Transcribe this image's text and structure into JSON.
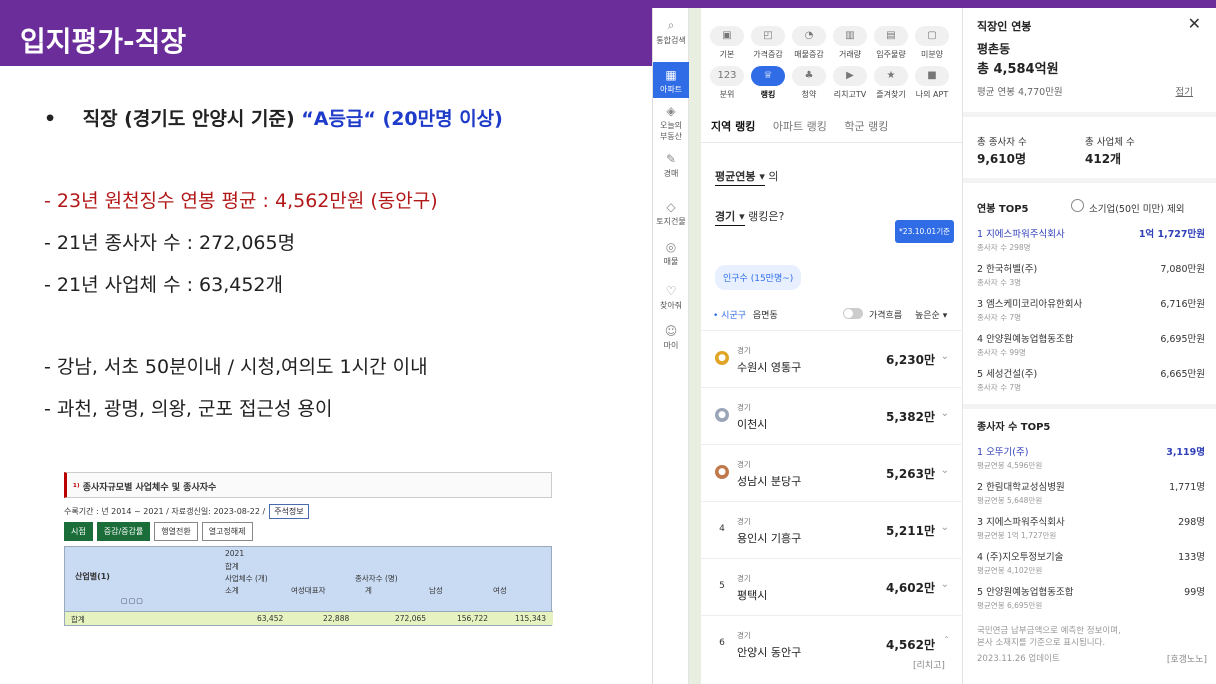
{
  "slide_title": "입지평가-직장",
  "bullet": {
    "prefix": "직장 (경기도 안양시 기준)",
    "grade": "“A등급“ (20만명 이상)"
  },
  "lines": [
    "- 23년 원천징수 연봉 평균 : 4,562만원 (동안구)",
    "- 21년 종사자 수 : 272,065명",
    "- 21년 사업체 수 : 63,452개",
    "-   강남, 서초 50분이내 / 시청,여의도 1시간 이내",
    "-   과천, 광명, 의왕, 군포 접근성 용이"
  ],
  "table": {
    "title": "종사자규모별 사업체수 및 종사자수",
    "meta": "수록기간 : 년 2014 ~ 2021 / 자료갱신일: 2023-08-22 /",
    "meta_btn": "주석정보",
    "buttons": [
      "시점",
      "증감/증감률",
      "행열전환",
      "열고정해제"
    ],
    "row_header": "산업별(1)",
    "year": "2021",
    "total": "합계",
    "g1": "사업체수 (개)",
    "g2": "종사자수 (명)",
    "cols": [
      "소계",
      "여성대표자",
      "계",
      "남성",
      "여성"
    ],
    "row_label": "합계",
    "values": [
      "63,452",
      "22,888",
      "272,065",
      "156,722",
      "115,343"
    ]
  },
  "sidebar": [
    {
      "icon": "⌕",
      "label": "통합검색"
    },
    {
      "icon": "▦",
      "label": "아파트"
    },
    {
      "icon": "◈",
      "label": "오늘의\n부동산"
    },
    {
      "icon": "✎",
      "label": "경매"
    },
    {
      "icon": "◇",
      "label": "토지건물"
    },
    {
      "icon": "◎",
      "label": "매물"
    },
    {
      "icon": "♡",
      "label": "찾아줘"
    },
    {
      "icon": "☺",
      "label": "마이"
    }
  ],
  "categories": [
    "기본",
    "가격증감",
    "매물증감",
    "거래량",
    "입주물량",
    "미분양",
    "분위",
    "랭킹",
    "청약",
    "리치고TV",
    "즐겨찾기",
    "나의 APT"
  ],
  "tabs": [
    "지역 랭킹",
    "아파트 랭킹",
    "학군 랭킹"
  ],
  "sel1": {
    "value": "평균연봉",
    "suffix": "의"
  },
  "sel2": {
    "value": "경기",
    "suffix": "랭킹은?"
  },
  "date_badge": "*23.10.01기준",
  "chip": "인구수 (15만명~)",
  "filter": {
    "a": "• 시군구",
    "b": "읍면동",
    "c": "가격흐름",
    "d": "높은순"
  },
  "ranking": [
    {
      "rank": "1",
      "prov": "경기",
      "name": "수원시 영통구",
      "value": "6,230만"
    },
    {
      "rank": "2",
      "prov": "경기",
      "name": "이천시",
      "value": "5,382만"
    },
    {
      "rank": "3",
      "prov": "경기",
      "name": "성남시 분당구",
      "value": "5,263만"
    },
    {
      "rank": "4",
      "prov": "경기",
      "name": "용인시 기흥구",
      "value": "5,211만"
    },
    {
      "rank": "5",
      "prov": "경기",
      "name": "평택시",
      "value": "4,602만"
    },
    {
      "rank": "6",
      "prov": "경기",
      "name": "안양시 동안구",
      "value": "4,562만"
    }
  ],
  "footer_left": "[리치고]",
  "panel": {
    "title": "직장인 연봉",
    "area": "평촌동",
    "total": "총 4,584억원",
    "avg": "평균 연봉 4,770만원",
    "fold": "접기",
    "emp_label": "총 종사자 수",
    "emp": "9,610명",
    "biz_label": "총 사업체 수",
    "biz": "412개",
    "top5_title": "연봉 TOP5",
    "exclude": "소기업(50인 미만) 제외",
    "top5": [
      {
        "n": "1 지에스파워주식회사",
        "s": "종사자 수 298명",
        "v": "1억 1,727만원"
      },
      {
        "n": "2 한국허벨(주)",
        "s": "종사자 수 3명",
        "v": "7,080만원"
      },
      {
        "n": "3 엠스케미코리아유한회사",
        "s": "종사자 수 7명",
        "v": "6,716만원"
      },
      {
        "n": "4 안양원예농업협동조합",
        "s": "종사자 수 99명",
        "v": "6,695만원"
      },
      {
        "n": "5 세성건설(주)",
        "s": "종사자 수 7명",
        "v": "6,665만원"
      }
    ],
    "emp5_title": "종사자 수 TOP5",
    "emp5": [
      {
        "n": "1 오뚜기(주)",
        "s": "평균연봉 4,596만원",
        "v": "3,119명"
      },
      {
        "n": "2 한림대학교성심병원",
        "s": "평균연봉 5,648만원",
        "v": "1,771명"
      },
      {
        "n": "3 지에스파워주식회사",
        "s": "평균연봉 1억 1,727만원",
        "v": "298명"
      },
      {
        "n": "4 (주)지오투정보기술",
        "s": "평균연봉 4,102만원",
        "v": "133명"
      },
      {
        "n": "5 안양원예농업협동조합",
        "s": "평균연봉 6,695만원",
        "v": "99명"
      }
    ],
    "note1": "국민연금 납부금액으로 예측한 정보이며,",
    "note2": "본사 소재지를 기준으로 표시됩니다.",
    "updated": "2023.11.26 업데이트",
    "footer_right": "[호갱노노]"
  }
}
